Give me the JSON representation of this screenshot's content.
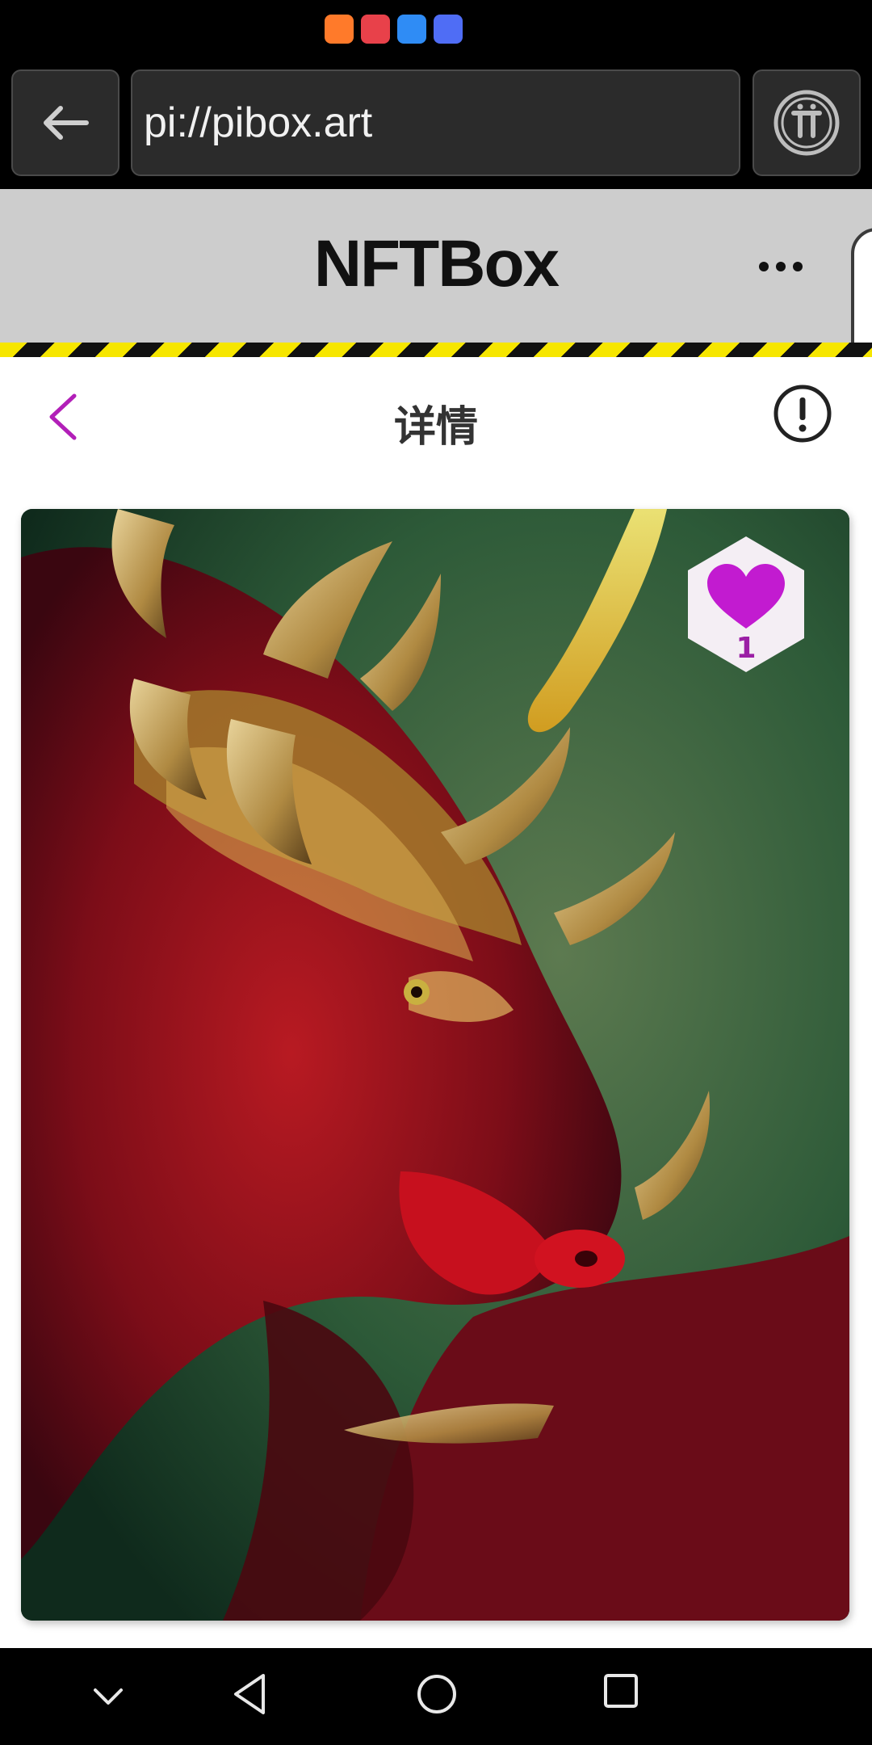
{
  "browser": {
    "url": "pi://pibox.art"
  },
  "app": {
    "title": "NFTBox"
  },
  "detail": {
    "title": "详情"
  },
  "artwork": {
    "likes": "1"
  },
  "colors": {
    "accent": "#b21fb8",
    "header_bg": "#cdcdcd",
    "hazard_yellow": "#f6e600"
  },
  "icons": [
    "back-arrow-icon",
    "pi-logo-icon",
    "more-icon",
    "chevron-left-icon",
    "info-icon",
    "heart-icon",
    "nav-collapse-icon",
    "nav-back-icon",
    "nav-home-icon",
    "nav-recents-icon"
  ]
}
